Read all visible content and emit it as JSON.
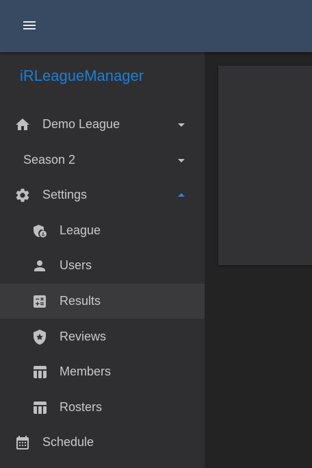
{
  "appbar": {
    "menu_icon": "hamburger-menu-icon"
  },
  "drawer": {
    "brand": "iRLeagueManager",
    "league_selector": {
      "label": "Demo League",
      "icon": "home-icon",
      "state": "collapsed"
    },
    "season_selector": {
      "label": "Season 2",
      "state": "collapsed"
    },
    "settings": {
      "label": "Settings",
      "icon": "gear-icon",
      "state": "expanded",
      "children": [
        {
          "label": "League",
          "icon": "admin-shield-icon"
        },
        {
          "label": "Users",
          "icon": "person-icon"
        },
        {
          "label": "Results",
          "icon": "calculator-icon",
          "active": true
        },
        {
          "label": "Reviews",
          "icon": "shield-star-icon"
        },
        {
          "label": "Members",
          "icon": "table-icon"
        },
        {
          "label": "Rosters",
          "icon": "table-icon"
        }
      ]
    },
    "schedule": {
      "label": "Schedule",
      "icon": "calendar-icon"
    }
  },
  "colors": {
    "appbar": "#374a61",
    "drawer": "#2f2f32",
    "background": "#232323",
    "brand": "#1c7fd8",
    "active_item": "#3a3a3d",
    "expanded_caret": "#2a86e0"
  }
}
